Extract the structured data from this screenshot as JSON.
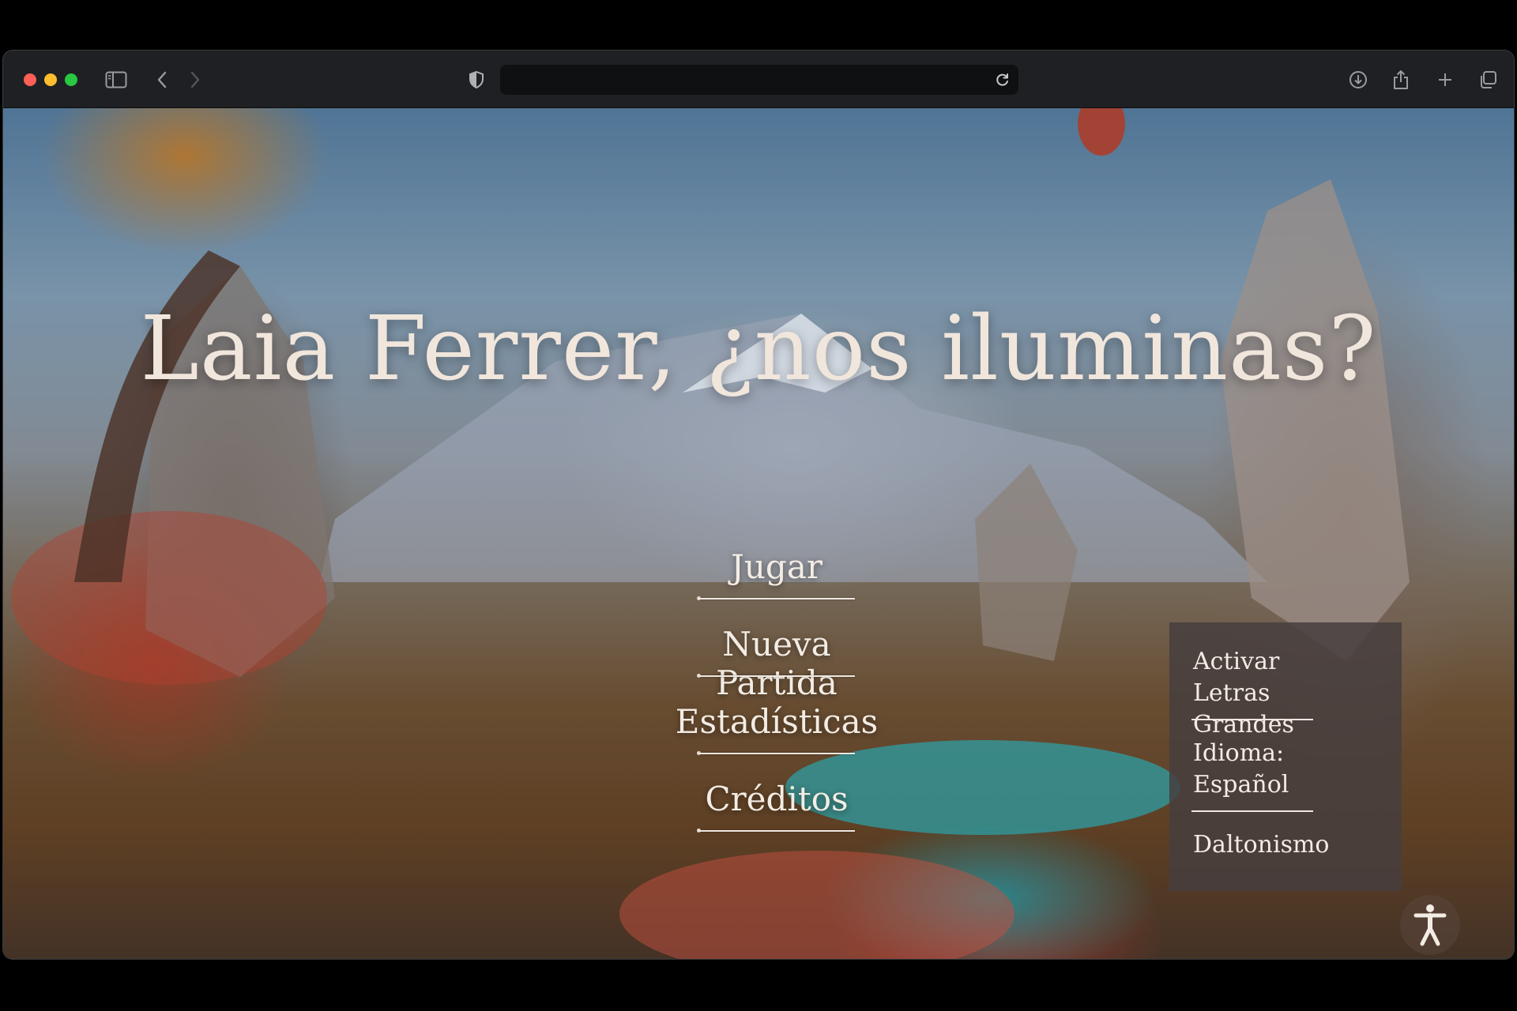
{
  "browser": {
    "address_value": "",
    "icons": {
      "sidebar": "sidebar-icon",
      "back": "back-arrow-icon",
      "forward": "forward-arrow-icon",
      "shield": "shield-icon",
      "reload": "reload-icon",
      "download": "download-icon",
      "share": "share-icon",
      "new_tab": "plus-icon",
      "tabs": "tabs-overview-icon"
    }
  },
  "page": {
    "title": "Laia Ferrer, ¿nos iluminas?",
    "menu": [
      {
        "label": "Jugar"
      },
      {
        "label": "Nueva Partida"
      },
      {
        "label": "Estadísticas"
      },
      {
        "label": "Créditos"
      }
    ],
    "settings_panel": {
      "large_text": "Activar Letras Grandes",
      "language": "Idioma: Español",
      "colorblind": "Daltonismo"
    },
    "accessibility_icon": "accessibility-person-icon"
  },
  "colors": {
    "text": "#f1e6dc",
    "panel_bg": "#463e3e"
  }
}
